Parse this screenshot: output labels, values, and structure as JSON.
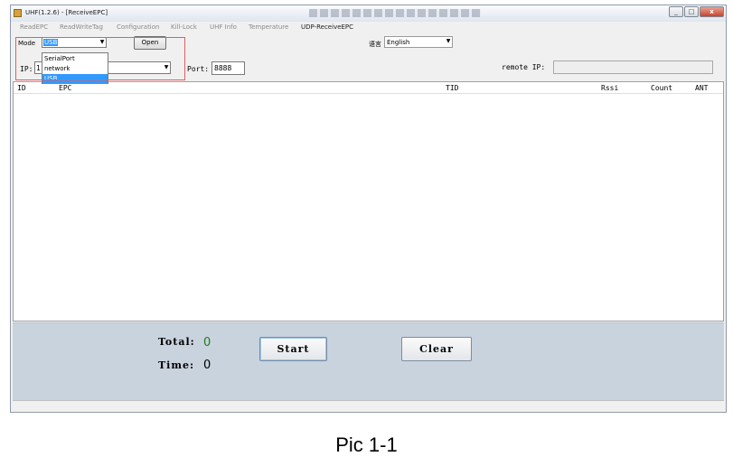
{
  "window": {
    "title": "UHF(1.2.6) - [ReceiveEPC]",
    "minimize": "_",
    "maximize": "□",
    "close": "x"
  },
  "tabs": [
    {
      "label": "ReadEPC"
    },
    {
      "label": "ReadWriteTag"
    },
    {
      "label": "Configuration"
    },
    {
      "label": "Kill-Lock"
    },
    {
      "label": "UHF Info"
    },
    {
      "label": "Temperature"
    },
    {
      "label": "UDP-ReceiveEPC"
    }
  ],
  "mode": {
    "label": "Mode",
    "selected": "USB",
    "options": [
      "SerialPort",
      "network",
      "USB"
    ]
  },
  "open_button": "Open",
  "language": {
    "icon_text": "语言",
    "selected": "English"
  },
  "network": {
    "ip_label": "IP:",
    "ip_value": "1",
    "port_label": "Port:",
    "port_value": "8888",
    "remote_ip_label": "remote IP:",
    "remote_ip_value": ""
  },
  "table": {
    "columns": [
      "ID",
      "EPC",
      "TID",
      "Rssi",
      "Count",
      "ANT"
    ]
  },
  "stats": {
    "total_label": "Total:",
    "total_value": "0",
    "time_label": "Time:",
    "time_value": "0"
  },
  "buttons": {
    "start": "Start",
    "clear": "Clear"
  },
  "caption": "Pic 1-1"
}
